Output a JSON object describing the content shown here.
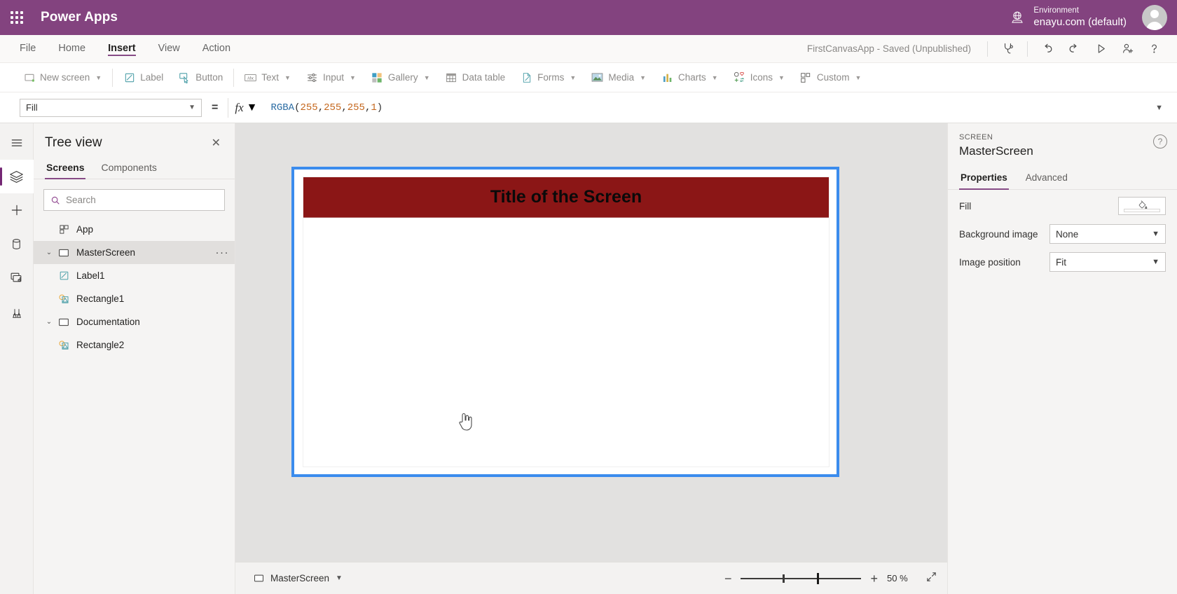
{
  "topbar": {
    "waffle_label": "app-launcher",
    "brand": "Power Apps",
    "environment_label": "Environment",
    "environment_value": "enayu.com (default)"
  },
  "menubar": {
    "items": [
      {
        "label": "File",
        "active": false
      },
      {
        "label": "Home",
        "active": false
      },
      {
        "label": "Insert",
        "active": true
      },
      {
        "label": "View",
        "active": false
      },
      {
        "label": "Action",
        "active": false
      }
    ],
    "app_status": "FirstCanvasApp - Saved (Unpublished)",
    "actions": [
      {
        "name": "app-checker-icon",
        "title": "App checker"
      },
      {
        "name": "undo-icon",
        "title": "Undo"
      },
      {
        "name": "redo-icon",
        "title": "Redo"
      },
      {
        "name": "preview-play-icon",
        "title": "Preview the app"
      },
      {
        "name": "share-person-add-icon",
        "title": "Share"
      },
      {
        "name": "help-icon",
        "title": "Help"
      }
    ]
  },
  "ribbon": {
    "items": [
      {
        "label": "New screen",
        "icon": "new-screen-icon",
        "chevron": true
      },
      {
        "label": "Label",
        "icon": "label-icon",
        "chevron": false
      },
      {
        "label": "Button",
        "icon": "button-icon",
        "chevron": false
      },
      {
        "label": "Text",
        "icon": "text-icon",
        "chevron": true
      },
      {
        "label": "Input",
        "icon": "input-icon",
        "chevron": true
      },
      {
        "label": "Gallery",
        "icon": "gallery-icon",
        "chevron": true
      },
      {
        "label": "Data table",
        "icon": "data-table-icon",
        "chevron": false
      },
      {
        "label": "Forms",
        "icon": "forms-icon",
        "chevron": true
      },
      {
        "label": "Media",
        "icon": "media-icon",
        "chevron": true
      },
      {
        "label": "Charts",
        "icon": "charts-icon",
        "chevron": true
      },
      {
        "label": "Icons",
        "icon": "icons-icon",
        "chevron": true
      },
      {
        "label": "Custom",
        "icon": "custom-icon",
        "chevron": true
      }
    ]
  },
  "formula_bar": {
    "property": "Fill",
    "equals": "=",
    "fx_label": "fx",
    "formula_tokens": [
      {
        "text": "RGBA",
        "type": "fn"
      },
      {
        "text": "(",
        "type": "punct"
      },
      {
        "text": "255",
        "type": "num"
      },
      {
        "text": ", ",
        "type": "punct"
      },
      {
        "text": "255",
        "type": "num"
      },
      {
        "text": ", ",
        "type": "punct"
      },
      {
        "text": "255",
        "type": "num"
      },
      {
        "text": ", ",
        "type": "punct"
      },
      {
        "text": "1",
        "type": "num"
      },
      {
        "text": ")",
        "type": "punct"
      }
    ],
    "formula_text": "RGBA(255, 255, 255, 1)"
  },
  "rail": {
    "items": [
      {
        "name": "hamburger-menu-icon",
        "active": false
      },
      {
        "name": "tree-view-layers-icon",
        "active": true
      },
      {
        "name": "insert-plus-icon",
        "active": false
      },
      {
        "name": "data-cylinder-icon",
        "active": false
      },
      {
        "name": "media-icon",
        "active": false
      },
      {
        "name": "advanced-tools-icon",
        "active": false
      }
    ]
  },
  "tree_view": {
    "title": "Tree view",
    "close_label": "✕",
    "tabs": [
      {
        "label": "Screens",
        "active": true
      },
      {
        "label": "Components",
        "active": false
      }
    ],
    "search_placeholder": "Search",
    "search_value": "",
    "nodes": [
      {
        "label": "App",
        "icon": "app-icon",
        "indent": 0,
        "twisty": "",
        "selected": false,
        "menu": false
      },
      {
        "label": "MasterScreen",
        "icon": "screen-icon",
        "indent": 0,
        "twisty": "⌄",
        "selected": true,
        "menu": true
      },
      {
        "label": "Label1",
        "icon": "label-icon",
        "indent": 1,
        "twisty": "",
        "selected": false,
        "menu": false
      },
      {
        "label": "Rectangle1",
        "icon": "rectangle-shape-icon",
        "indent": 1,
        "twisty": "",
        "selected": false,
        "menu": false
      },
      {
        "label": "Documentation",
        "icon": "screen-icon",
        "indent": 0,
        "twisty": "⌄",
        "selected": false,
        "menu": false
      },
      {
        "label": "Rectangle2",
        "icon": "rectangle-shape-icon",
        "indent": 1,
        "twisty": "",
        "selected": false,
        "menu": false
      }
    ]
  },
  "canvas": {
    "screen_title": "Title of the Screen",
    "banner_color": "#8b1616",
    "selection_color": "#3b8ced",
    "background_color": "#e2e1e0"
  },
  "status_bar": {
    "screen_name": "MasterScreen",
    "zoom_minus": "−",
    "zoom_plus": "+",
    "zoom_value": "50",
    "zoom_unit": "%",
    "fit_label": "fit-to-screen-icon"
  },
  "properties_panel": {
    "kind": "SCREEN",
    "name": "MasterScreen",
    "help_label": "?",
    "tabs": [
      {
        "label": "Properties",
        "active": true
      },
      {
        "label": "Advanced",
        "active": false
      }
    ],
    "rows": [
      {
        "label": "Fill",
        "control": "swatch",
        "value": ""
      },
      {
        "label": "Background image",
        "control": "select",
        "value": "None"
      },
      {
        "label": "Image position",
        "control": "select",
        "value": "Fit"
      }
    ]
  }
}
